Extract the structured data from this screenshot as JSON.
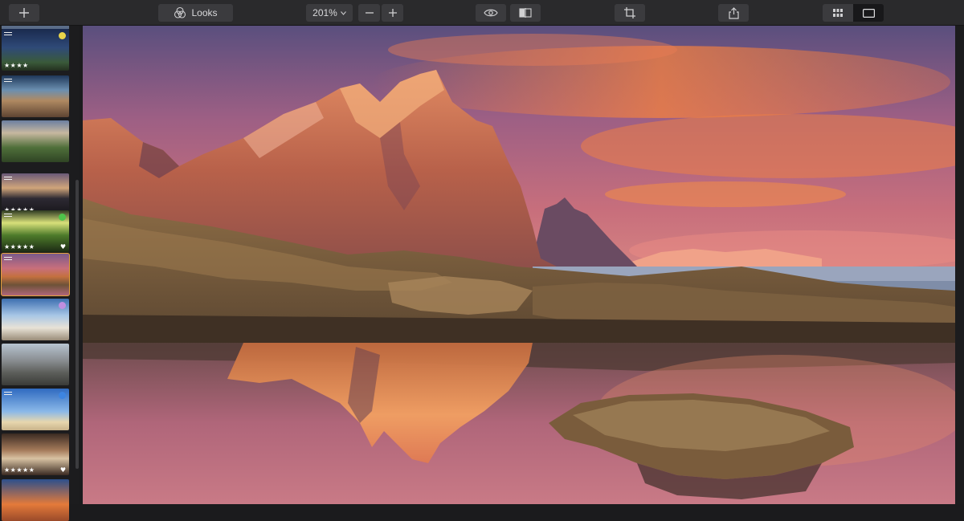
{
  "toolbar": {
    "add_icon": "plus-icon",
    "looks_label": "Looks",
    "zoom_value": "201%",
    "zoom_out_icon": "minus-icon",
    "zoom_in_icon": "plus-icon",
    "preview_icon": "eye-icon",
    "compare_icon": "split-compare-icon",
    "crop_icon": "crop-icon",
    "share_icon": "share-icon",
    "grid_view_icon": "grid-icon",
    "single_view_icon": "single-view-icon"
  },
  "filmstrip": {
    "thumbnails": [
      {
        "subject": "night sky over field",
        "badge_color": "#e8d44a",
        "stars": "★★★★",
        "adjusted": true
      },
      {
        "subject": "canyon cliffs",
        "stars": "",
        "adjusted": true
      },
      {
        "subject": "green hills with ruin",
        "stars": "",
        "adjusted": false
      },
      {
        "subject": "dusk mountains",
        "stars": "★★★★★",
        "adjusted": true
      },
      {
        "subject": "green field with sun",
        "badge_color": "#4ec44a",
        "stars": "★★★★★",
        "heart": "♥",
        "adjusted": true
      },
      {
        "subject": "mountain reflection",
        "stars": "",
        "selected": true,
        "adjusted": true
      },
      {
        "subject": "surfer on beach",
        "badge_color": "#c08ee0",
        "stars": "",
        "adjusted": false
      },
      {
        "subject": "city street",
        "stars": "",
        "adjusted": false
      },
      {
        "subject": "lifeguard tower",
        "badge_color": "#3d84e0",
        "stars": "",
        "adjusted": true
      },
      {
        "subject": "arch interior",
        "stars": "★★★★★",
        "heart": "♥",
        "adjusted": false
      },
      {
        "subject": "orange sunset",
        "stars": "",
        "adjusted": false
      }
    ]
  },
  "colors": {
    "selection": "#e5a23a",
    "toolbar_bg": "#2a2a2c",
    "panel_bg": "#1c1c1e"
  }
}
